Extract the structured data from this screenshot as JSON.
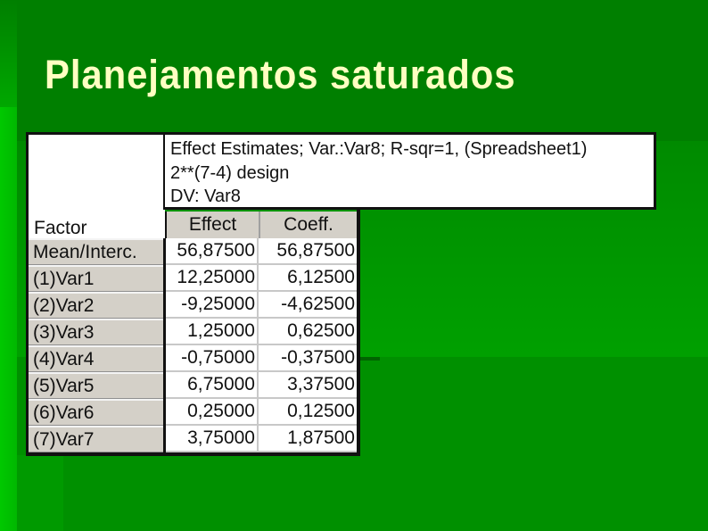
{
  "slide": {
    "title": "Planejamentos saturados",
    "colors": {
      "background_green": "#008a00",
      "title_color": "#ffffc2",
      "table_header_gray": "#d4d0c8"
    }
  },
  "table": {
    "header_lines": [
      "Effect Estimates; Var.:Var8; R-sqr=1, (Spreadsheet1)",
      "2**(7-4) design",
      "DV: Var8"
    ],
    "columns": {
      "factor": "Factor",
      "effect": "Effect",
      "coeff": "Coeff."
    },
    "rows": [
      {
        "factor": "Mean/Interc.",
        "effect": "56,87500",
        "coeff": "56,87500"
      },
      {
        "factor": "(1)Var1",
        "effect": "12,25000",
        "coeff": "6,12500"
      },
      {
        "factor": "(2)Var2",
        "effect": "-9,25000",
        "coeff": "-4,62500"
      },
      {
        "factor": "(3)Var3",
        "effect": "1,25000",
        "coeff": "0,62500"
      },
      {
        "factor": "(4)Var4",
        "effect": "-0,75000",
        "coeff": "-0,37500"
      },
      {
        "factor": "(5)Var5",
        "effect": "6,75000",
        "coeff": "3,37500"
      },
      {
        "factor": "(6)Var6",
        "effect": "0,25000",
        "coeff": "0,12500"
      },
      {
        "factor": "(7)Var7",
        "effect": "3,75000",
        "coeff": "1,87500"
      }
    ]
  }
}
